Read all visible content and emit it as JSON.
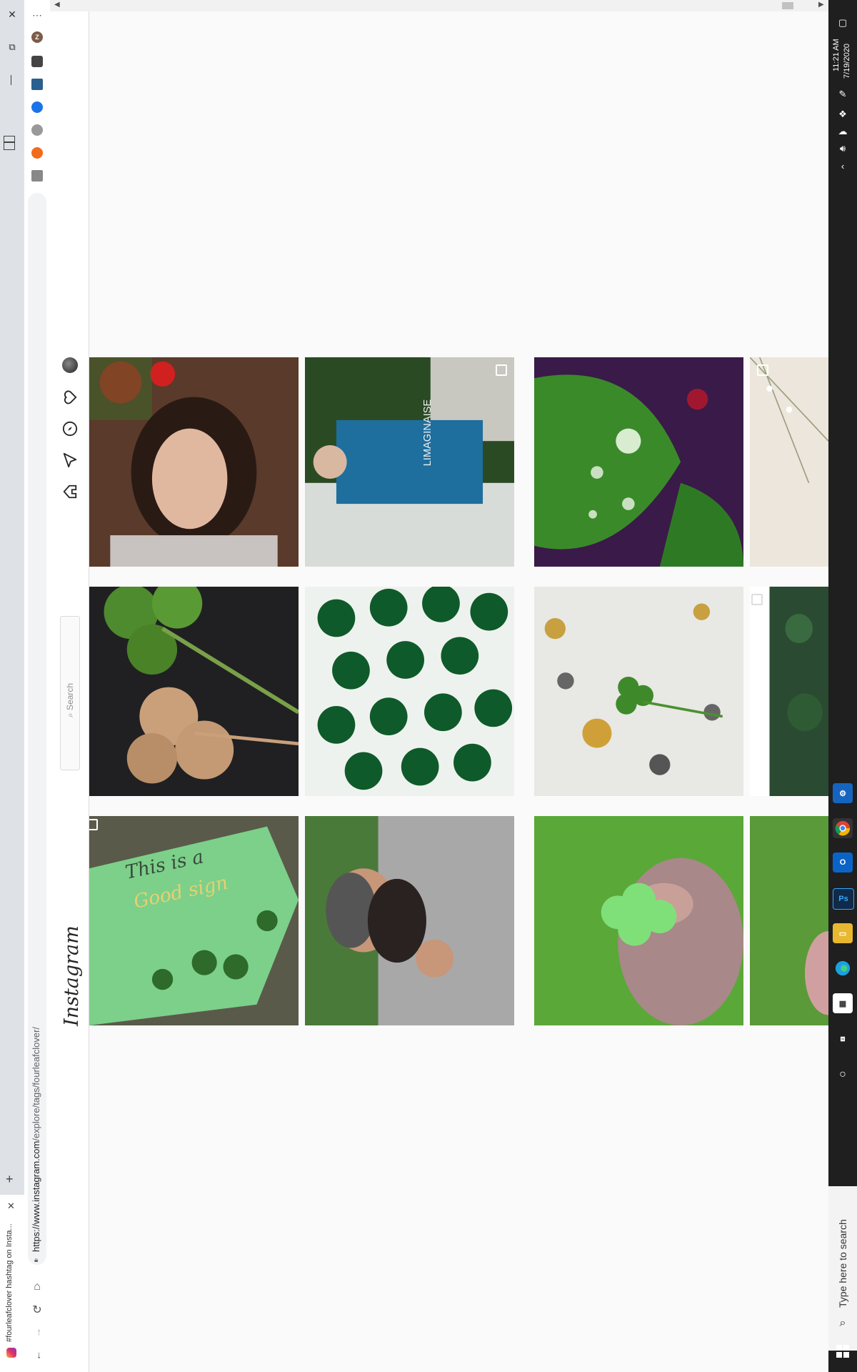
{
  "browser": {
    "tab_title": "#fourleafclover hashtag on Insta...",
    "tab_close": "✕",
    "new_tab": "+",
    "url_host": "https://www.instagram.com",
    "url_path": "/explore/tags/fourleafclover/",
    "window_close": "✕",
    "window_restore": "⧉",
    "window_minimize": "—",
    "menu": "⋯",
    "profile_initial": "Z",
    "nav_back": "←",
    "nav_forward": "→",
    "reload": "↻",
    "home": "⌂"
  },
  "instagram": {
    "logo": "Instagram",
    "search_placeholder": "Search",
    "nav_icons": [
      "home-icon",
      "direct-icon",
      "explore-icon",
      "heart-icon",
      "profile-avatar"
    ]
  },
  "grid": {
    "tiles": [
      {
        "desc": "woman with red flowers",
        "multi": false
      },
      {
        "desc": "woman in blue dress in garden",
        "multi": true
      },
      {
        "desc": "water drops on clover leaf",
        "multi": false
      },
      {
        "desc": "white flowers",
        "multi": true
      },
      {
        "desc": "dried four leaf clovers",
        "multi": false
      },
      {
        "desc": "green clover shapes",
        "multi": false
      },
      {
        "desc": "clover on cracked paint",
        "multi": false
      },
      {
        "desc": "plant",
        "multi": true
      },
      {
        "desc": "This is a Good sign clover board",
        "multi": true
      },
      {
        "desc": "bearded man holding clover",
        "multi": false
      },
      {
        "desc": "hand holding four leaf clover",
        "multi": false
      },
      {
        "desc": "green grass",
        "multi": false
      }
    ],
    "sign_text_1": "This is a",
    "sign_text_2": "Good sign"
  },
  "taskbar": {
    "time": "11:21 AM",
    "date": "7/19/2020",
    "search_placeholder": "Type here to search",
    "apps": [
      "settings-app",
      "chrome-app",
      "outlook-app",
      "photoshop-app",
      "file-explorer-app",
      "edge-app",
      "store-app",
      "task-view",
      "cortana"
    ],
    "ps_label": "Ps"
  },
  "colors": {
    "instagram_bg": "#fafafa",
    "taskbar": "#1f1f1f",
    "tabstrip": "#dee1e6"
  }
}
